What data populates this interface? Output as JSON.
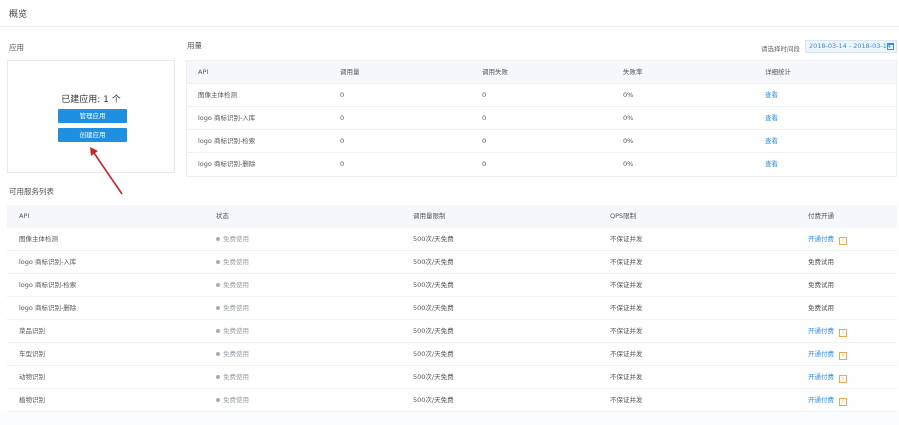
{
  "page": {
    "title": "概览"
  },
  "app_section": {
    "title": "应用",
    "count_text": "已建应用: 1 个",
    "manage_button": "管理应用",
    "create_button": "创建应用"
  },
  "usage_section": {
    "title": "用量",
    "date_label": "请选择时间段",
    "date_range": "2018-03-14 - 2018-03-14",
    "headers": [
      "API",
      "调用量",
      "调用失败",
      "失败率",
      "详细统计"
    ],
    "rows": [
      [
        "图像主体检测",
        "0",
        "0",
        "0%",
        "查看"
      ],
      [
        "logo 商标识别-入库",
        "0",
        "0",
        "0%",
        "查看"
      ],
      [
        "logo 商标识别-检索",
        "0",
        "0",
        "0%",
        "查看"
      ],
      [
        "logo 商标识别-删除",
        "0",
        "0",
        "0%",
        "查看"
      ]
    ]
  },
  "services_section": {
    "title": "可用服务列表",
    "headers": [
      "API",
      "状态",
      "调用量限制",
      "QPS限制",
      "付费开通"
    ],
    "rows": [
      {
        "api": "图像主体检测",
        "status": "免费使用",
        "limit": "500次/天免费",
        "qps": "不保证并发",
        "pay": "开通付费",
        "pay_link": true
      },
      {
        "api": "logo 商标识别-入库",
        "status": "免费使用",
        "limit": "500次/天免费",
        "qps": "不保证并发",
        "pay": "免费试用",
        "pay_link": false
      },
      {
        "api": "logo 商标识别-检索",
        "status": "免费使用",
        "limit": "500次/天免费",
        "qps": "不保证并发",
        "pay": "免费试用",
        "pay_link": false
      },
      {
        "api": "logo 商标识别-删除",
        "status": "免费使用",
        "limit": "500次/天免费",
        "qps": "不保证并发",
        "pay": "免费试用",
        "pay_link": false
      },
      {
        "api": "菜品识别",
        "status": "免费使用",
        "limit": "500次/天免费",
        "qps": "不保证并发",
        "pay": "开通付费",
        "pay_link": true
      },
      {
        "api": "车型识别",
        "status": "免费使用",
        "limit": "500次/天免费",
        "qps": "不保证并发",
        "pay": "开通付费",
        "pay_link": true
      },
      {
        "api": "动物识别",
        "status": "免费使用",
        "limit": "500次/天免费",
        "qps": "不保证并发",
        "pay": "开通付费",
        "pay_link": true
      },
      {
        "api": "植物识别",
        "status": "免费使用",
        "limit": "500次/天免费",
        "qps": "不保证并发",
        "pay": "开通付费",
        "pay_link": true
      }
    ],
    "info_icon_glyph": "i"
  },
  "colors": {
    "accent": "#1e8fe1",
    "link": "#2d8de6",
    "warning": "#f0a64a",
    "annotation_arrow": "#c62828"
  }
}
